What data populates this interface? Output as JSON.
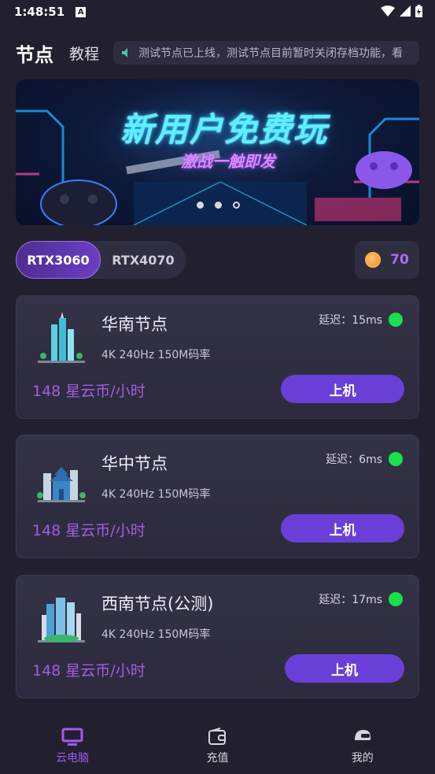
{
  "status_bar": {
    "time": "1:48:51",
    "notification_badge": "A"
  },
  "header": {
    "title": "节点",
    "tutorial": "教程",
    "marquee": "测试节点已上线，测试节点目前暂时关闭存档功能，看"
  },
  "banner": {
    "title": "新用户免费玩",
    "subtitle": "激战一触即发",
    "page_count": 3,
    "active_index": 2
  },
  "gpu_tabs": [
    {
      "label": "RTX3060",
      "selected": true
    },
    {
      "label": "RTX4070",
      "selected": false
    }
  ],
  "coins": {
    "count": "70"
  },
  "nodes": [
    {
      "name": "华南节点",
      "spec": "4K 240Hz 150M码率",
      "latency": "延迟：15ms",
      "price": "148 星云币/小时",
      "button": "上机",
      "status_color": "#19e14a"
    },
    {
      "name": "华中节点",
      "spec": "4K 240Hz 150M码率",
      "latency": "延迟：6ms",
      "price": "148 星云币/小时",
      "button": "上机",
      "status_color": "#19e14a"
    },
    {
      "name": "西南节点(公测)",
      "spec": "4K 240Hz 150M码率",
      "latency": "延迟：17ms",
      "price": "148 星云币/小时",
      "button": "上机",
      "status_color": "#19e14a"
    }
  ],
  "tabbar": [
    {
      "label": "云电脑",
      "icon": "monitor-icon",
      "active": true
    },
    {
      "label": "充值",
      "icon": "wallet-icon",
      "active": false
    },
    {
      "label": "我的",
      "icon": "helmet-icon",
      "active": false
    }
  ],
  "colors": {
    "accent": "#6a3fd8",
    "price": "#a35ce6",
    "background": "#22202f",
    "online": "#19e14a"
  }
}
